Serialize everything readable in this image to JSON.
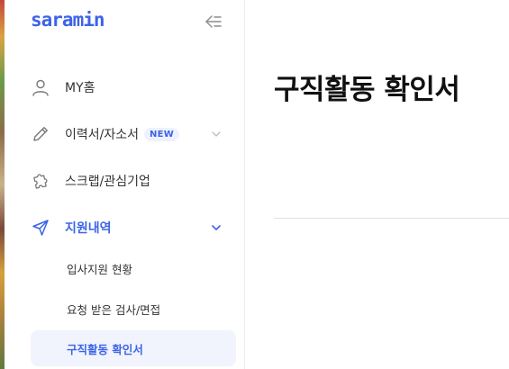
{
  "colors": {
    "accent": "#3c64e8",
    "badge_bg": "#eef2fe"
  },
  "sidebar": {
    "logo_text": "saramin",
    "collapse_icon": "collapse-left-icon",
    "items": [
      {
        "label": "MY홈",
        "icon": "user-icon"
      },
      {
        "label": "이력서/자소서",
        "icon": "pencil-icon",
        "badge": "NEW",
        "expandable": true
      },
      {
        "label": "스크랩/관심기업",
        "icon": "puzzle-icon"
      },
      {
        "label": "지원내역",
        "icon": "send-icon",
        "expandable": true,
        "expanded": true,
        "active": true
      }
    ],
    "subitems": [
      {
        "label": "입사지원 현황"
      },
      {
        "label": "요청 받은 검사/면접"
      },
      {
        "label": "구직활동 확인서",
        "active": true
      }
    ]
  },
  "main": {
    "title": "구직활동 확인서"
  }
}
